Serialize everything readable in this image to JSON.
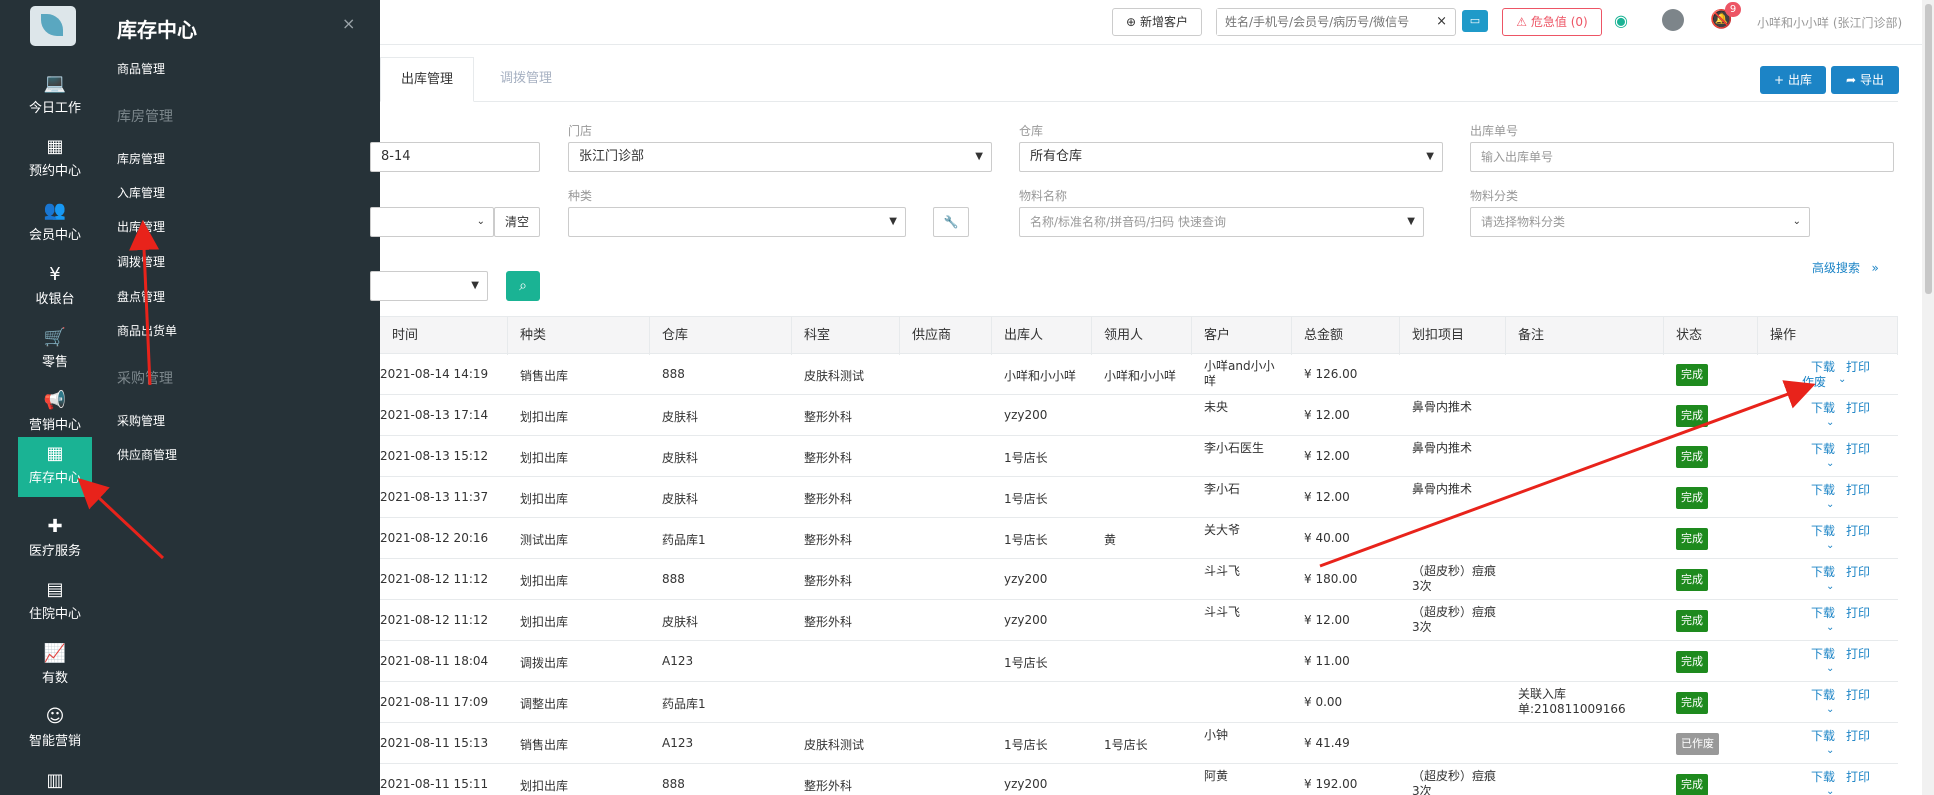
{
  "rail": {
    "items": [
      {
        "label": "今日工作",
        "icon": "laptop-icon",
        "glyph": "💻"
      },
      {
        "label": "预约中心",
        "icon": "calendar-icon",
        "glyph": "▦"
      },
      {
        "label": "会员中心",
        "icon": "users-icon",
        "glyph": "👥"
      },
      {
        "label": "收银台",
        "icon": "yen-icon",
        "glyph": "¥"
      },
      {
        "label": "零售",
        "icon": "cart-icon",
        "glyph": "🛒"
      },
      {
        "label": "营销中心",
        "icon": "megaphone-icon",
        "glyph": "📢"
      },
      {
        "label": "库存中心",
        "icon": "grid-icon",
        "glyph": "▦"
      },
      {
        "label": "医疗服务",
        "icon": "medkit-icon",
        "glyph": "✚"
      },
      {
        "label": "住院中心",
        "icon": "building-icon",
        "glyph": "▤"
      },
      {
        "label": "有数",
        "icon": "line-chart-icon",
        "glyph": "📈"
      },
      {
        "label": "智能营销",
        "icon": "robot-icon",
        "glyph": "☺"
      },
      {
        "label": "",
        "icon": "bar-chart-icon",
        "glyph": "▥"
      }
    ]
  },
  "flyout": {
    "title": "库存中心",
    "close": "×",
    "items": [
      {
        "label": "商品管理",
        "kind": "item"
      },
      {
        "label": "库房管理",
        "kind": "group"
      },
      {
        "label": "库房管理",
        "kind": "item"
      },
      {
        "label": "入库管理",
        "kind": "item"
      },
      {
        "label": "出库管理",
        "kind": "item"
      },
      {
        "label": "调拨管理",
        "kind": "item"
      },
      {
        "label": "盘点管理",
        "kind": "item"
      },
      {
        "label": "商品出货单",
        "kind": "item"
      },
      {
        "label": "采购管理",
        "kind": "group"
      },
      {
        "label": "采购管理",
        "kind": "item"
      },
      {
        "label": "供应商管理",
        "kind": "item"
      }
    ]
  },
  "topbar": {
    "new_customer": "新增客户",
    "search_placeholder": "姓名/手机号/会员号/病历号/微信号",
    "search_clear": "×",
    "danger_label": "危急值",
    "danger_count": "0",
    "bell_badge": "9",
    "user": "小咩和小小咩 (张江门诊部)"
  },
  "tabs": [
    {
      "label": "出库管理",
      "active": true
    },
    {
      "label": "调拨管理",
      "active": false
    }
  ],
  "actions": {
    "outbound": "出库",
    "export": "导出"
  },
  "filters": {
    "date_value": "8-14",
    "store_label": "门店",
    "store_value": "张江门诊部",
    "warehouse_label": "仓库",
    "warehouse_value": "所有仓库",
    "order_no_label": "出库单号",
    "order_no_placeholder": "输入出库单号",
    "clear": "清空",
    "kind_label": "种类",
    "material_label": "物料名称",
    "material_placeholder": "名称/标准名称/拼音码/扫码 快速查询",
    "category_label": "物料分类",
    "category_placeholder": "请选择物料分类",
    "advanced": "高级搜索"
  },
  "table": {
    "headers": [
      "时间",
      "种类",
      "仓库",
      "科室",
      "供应商",
      "出库人",
      "领用人",
      "客户",
      "总金额",
      "划扣项目",
      "备注",
      "状态",
      "操作"
    ],
    "rows": [
      {
        "time": "2021-08-14 14:19",
        "kind": "销售出库",
        "warehouse": "888",
        "dept": "皮肤科测试",
        "supplier": "",
        "out_by": "小咩和小小咩",
        "receiver": "小咩和小小咩",
        "customer": "小咩and小小咩",
        "amount": "¥ 126.00",
        "item": "",
        "note": "",
        "status": "完成",
        "op1": "下载",
        "op2": "打印",
        "op3": "作废",
        "void": false
      },
      {
        "time": "2021-08-13 17:14",
        "kind": "划扣出库",
        "warehouse": "皮肤科",
        "dept": "整形外科",
        "supplier": "",
        "out_by": "yzy200",
        "receiver": "",
        "customer": "未央",
        "amount": "¥ 12.00",
        "item": "鼻骨内推术",
        "note": "",
        "status": "完成",
        "op1": "下载",
        "op2": "打印",
        "op3": "",
        "void": false
      },
      {
        "time": "2021-08-13 15:12",
        "kind": "划扣出库",
        "warehouse": "皮肤科",
        "dept": "整形外科",
        "supplier": "",
        "out_by": "1号店长",
        "receiver": "",
        "customer": "李小石医生",
        "amount": "¥ 12.00",
        "item": "鼻骨内推术",
        "note": "",
        "status": "完成",
        "op1": "下载",
        "op2": "打印",
        "op3": "",
        "void": false
      },
      {
        "time": "2021-08-13 11:37",
        "kind": "划扣出库",
        "warehouse": "皮肤科",
        "dept": "整形外科",
        "supplier": "",
        "out_by": "1号店长",
        "receiver": "",
        "customer": "李小石",
        "amount": "¥ 12.00",
        "item": "鼻骨内推术",
        "note": "",
        "status": "完成",
        "op1": "下载",
        "op2": "打印",
        "op3": "",
        "void": false
      },
      {
        "time": "2021-08-12 20:16",
        "kind": "测试出库",
        "warehouse": "药品库1",
        "dept": "整形外科",
        "supplier": "",
        "out_by": "1号店长",
        "receiver": "黄",
        "customer": "关大爷",
        "amount": "¥ 40.00",
        "item": "",
        "note": "",
        "status": "完成",
        "op1": "下载",
        "op2": "打印",
        "op3": "",
        "void": false
      },
      {
        "time": "2021-08-12 11:12",
        "kind": "划扣出库",
        "warehouse": "888",
        "dept": "整形外科",
        "supplier": "",
        "out_by": "yzy200",
        "receiver": "",
        "customer": "斗斗飞",
        "amount": "¥ 180.00",
        "item": "（超皮秒）痘痕3次",
        "note": "",
        "status": "完成",
        "op1": "下载",
        "op2": "打印",
        "op3": "",
        "void": false
      },
      {
        "time": "2021-08-12 11:12",
        "kind": "划扣出库",
        "warehouse": "皮肤科",
        "dept": "整形外科",
        "supplier": "",
        "out_by": "yzy200",
        "receiver": "",
        "customer": "斗斗飞",
        "amount": "¥ 12.00",
        "item": "（超皮秒）痘痕3次",
        "note": "",
        "status": "完成",
        "op1": "下载",
        "op2": "打印",
        "op3": "",
        "void": false
      },
      {
        "time": "2021-08-11 18:04",
        "kind": "调拨出库",
        "warehouse": "A123",
        "dept": "",
        "supplier": "",
        "out_by": "1号店长",
        "receiver": "",
        "customer": "",
        "amount": "¥ 11.00",
        "item": "",
        "note": "",
        "status": "完成",
        "op1": "下载",
        "op2": "打印",
        "op3": "",
        "void": false
      },
      {
        "time": "2021-08-11 17:09",
        "kind": "调整出库",
        "warehouse": "药品库1",
        "dept": "",
        "supplier": "",
        "out_by": "",
        "receiver": "",
        "customer": "",
        "amount": "¥ 0.00",
        "item": "",
        "note": "关联入库单:210811009166",
        "status": "完成",
        "op1": "下载",
        "op2": "打印",
        "op3": "",
        "void": false
      },
      {
        "time": "2021-08-11 15:13",
        "kind": "销售出库",
        "warehouse": "A123",
        "dept": "皮肤科测试",
        "supplier": "",
        "out_by": "1号店长",
        "receiver": "1号店长",
        "customer": "小钟",
        "amount": "¥ 41.49",
        "item": "",
        "note": "",
        "status": "已作废",
        "op1": "下载",
        "op2": "打印",
        "op3": "",
        "void": true
      },
      {
        "time": "2021-08-11 15:11",
        "kind": "划扣出库",
        "warehouse": "888",
        "dept": "整形外科",
        "supplier": "",
        "out_by": "yzy200",
        "receiver": "",
        "customer": "阿黄",
        "amount": "¥ 192.00",
        "item": "（超皮秒）痘痕3次",
        "note": "",
        "status": "完成",
        "op1": "下载",
        "op2": "打印",
        "op3": "",
        "void": false
      }
    ]
  },
  "colors": {
    "sidebar": "#263238",
    "teal": "#1ab394",
    "primary": "#1c84c6",
    "status_done": "#1e8a1e",
    "annotation_red": "#e8231b"
  }
}
